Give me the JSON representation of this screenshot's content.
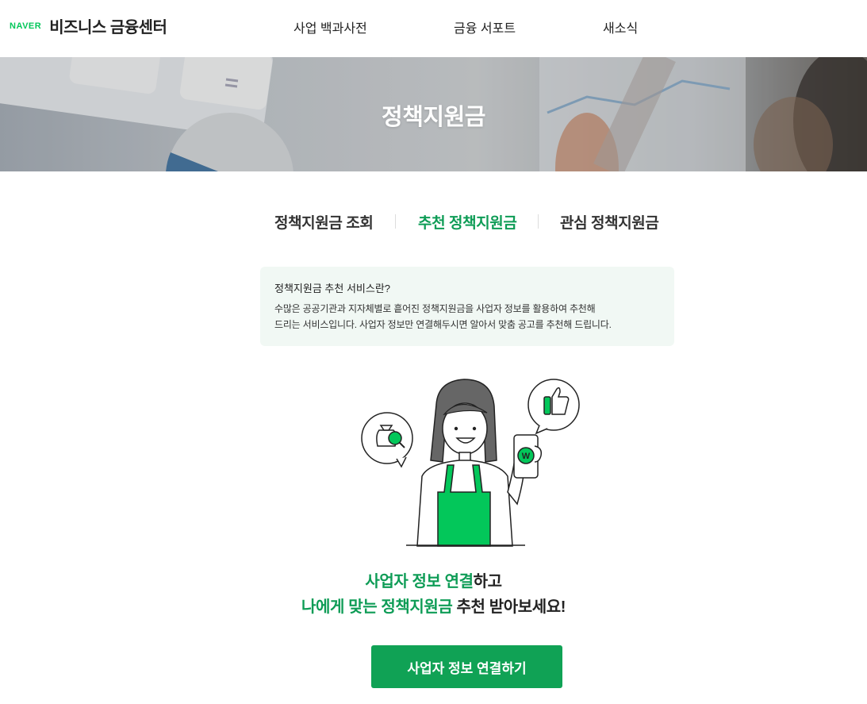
{
  "header": {
    "naver_label": "NAVER",
    "service_name": "비즈니스 금융센터",
    "nav": [
      "사업 백과사전",
      "금융 서포트",
      "새소식"
    ]
  },
  "hero": {
    "title": "정책지원금"
  },
  "tabs": [
    {
      "label": "정책지원금 조회",
      "active": false
    },
    {
      "label": "추천 정책지원금",
      "active": true
    },
    {
      "label": "관심 정책지원금",
      "active": false
    }
  ],
  "info": {
    "title": "정책지원금 추천 서비스란?",
    "desc_line1": "수많은 공공기관과 지자체별로 흩어진 정책지원금을 사업자 정보를 활용하여 추천해",
    "desc_line2": "드리는 서비스입니다. 사업자 정보만 연결해두시면 알아서 맞춤 공고를 추천해 드립니다."
  },
  "message": {
    "line1_green": "사업자 정보 연결",
    "line1_rest": "하고",
    "line2_green": "나에게 맞는 정책지원금",
    "line2_rest": " 추천 받아보세요!"
  },
  "cta": {
    "label": "사업자 정보 연결하기"
  },
  "illustration": {
    "phone_badge": "W"
  },
  "colors": {
    "brand_green": "#03c75a",
    "accent_green": "#0e9c56",
    "button_green": "#10a255",
    "info_bg": "#f1f8f4"
  }
}
